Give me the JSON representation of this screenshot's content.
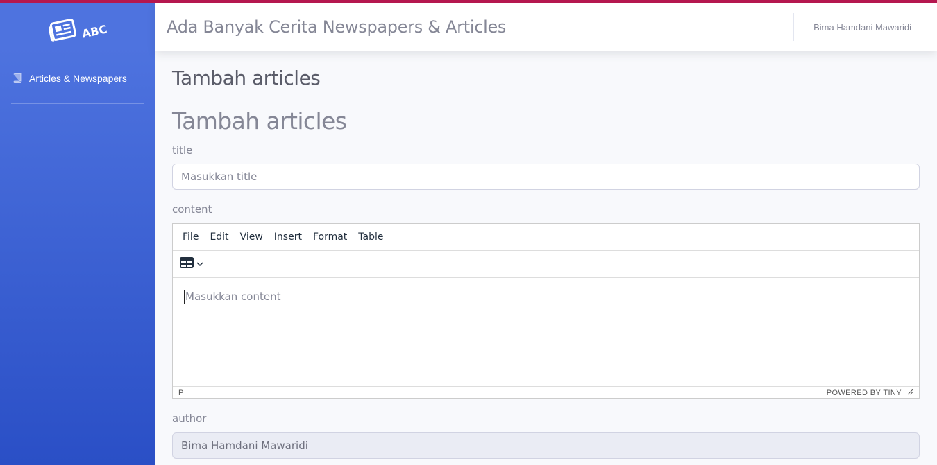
{
  "brand": {
    "logo_text": "ABC",
    "icon": "newspaper-icon"
  },
  "sidebar": {
    "items": [
      {
        "label": "Articles & Newspapers",
        "icon": "book-icon"
      }
    ]
  },
  "topbar": {
    "title": "Ada Banyak Cerita Newspapers & Articles",
    "user_name": "Bima Hamdani Mawaridi"
  },
  "page": {
    "heading": "Tambah articles",
    "form_heading": "Tambah articles"
  },
  "form": {
    "title": {
      "label": "title",
      "placeholder": "Masukkan title"
    },
    "content": {
      "label": "content",
      "menu": [
        "File",
        "Edit",
        "View",
        "Insert",
        "Format",
        "Table"
      ],
      "toolbar_icon": "table-icon",
      "placeholder": "Masukkan content",
      "status_path": "P",
      "powered_by": "POWERED BY TINY"
    },
    "author": {
      "label": "author",
      "value": "Bima Hamdani Mawaridi"
    }
  },
  "colors": {
    "accent_top": "#b5174f",
    "sidebar_start": "#4e73df",
    "sidebar_end": "#2a4fc6"
  }
}
